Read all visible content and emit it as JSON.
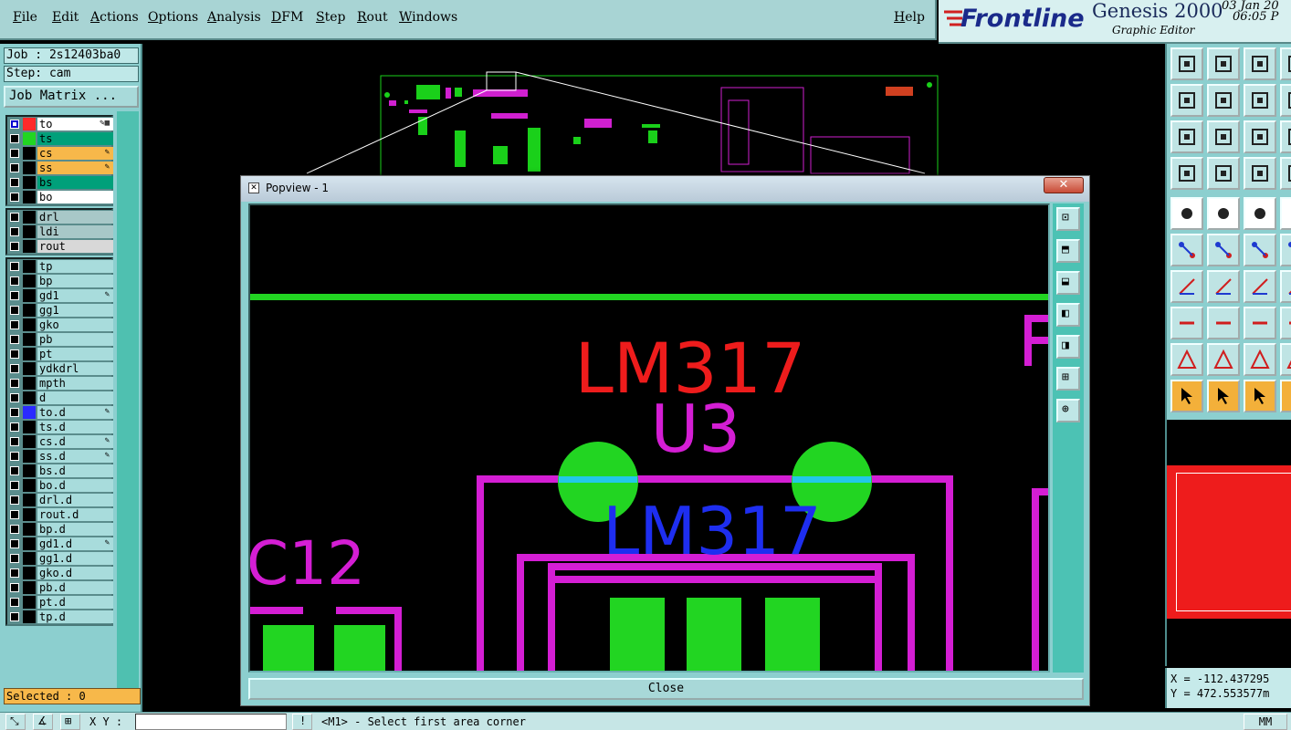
{
  "menubar": {
    "items": [
      "File",
      "Edit",
      "Actions",
      "Options",
      "Analysis",
      "DFM",
      "Step",
      "Rout",
      "Windows"
    ],
    "help": "Help"
  },
  "brand": {
    "logo": "Frontline",
    "product": "Genesis 2000",
    "subtitle": "Graphic Editor",
    "date": "03 Jan 20",
    "time": "06:05 P"
  },
  "left": {
    "job": "Job : 2s12403ba0",
    "step": "Step: cam",
    "job_matrix": "Job Matrix ...",
    "selected": "Selected : 0"
  },
  "layers": {
    "board": [
      {
        "name": "to",
        "color": "#ff2a2a",
        "bg": "#ffffff",
        "checked": true,
        "marker": "#0000d0",
        "icon": "✎▦"
      },
      {
        "name": "ts",
        "color": "#22d522",
        "bg": "#00a07a",
        "checked": false,
        "icon": ""
      },
      {
        "name": "cs",
        "color": "#000000",
        "bg": "#f7b84a",
        "checked": false,
        "icon": "✎"
      },
      {
        "name": "ss",
        "color": "#000000",
        "bg": "#f7b84a",
        "checked": false,
        "icon": "✎"
      },
      {
        "name": "bs",
        "color": "#000000",
        "bg": "#00a07a",
        "checked": false,
        "icon": ""
      },
      {
        "name": "bo",
        "color": "#000000",
        "bg": "#ffffff",
        "checked": false,
        "icon": ""
      }
    ],
    "drill": [
      {
        "name": "drl",
        "color": "#000000",
        "bg": "#a8c8c8",
        "checked": false,
        "icon": ""
      },
      {
        "name": "ldi",
        "color": "#000000",
        "bg": "#a8c8c8",
        "checked": false,
        "icon": ""
      },
      {
        "name": "rout",
        "color": "#000000",
        "bg": "#d8d8d8",
        "checked": false,
        "icon": ""
      }
    ],
    "misc": [
      {
        "name": "tp",
        "color": "#000000",
        "bg": "#a8dcdc",
        "checked": false,
        "icon": ""
      },
      {
        "name": "bp",
        "color": "#000000",
        "bg": "#a8dcdc",
        "checked": false,
        "icon": ""
      },
      {
        "name": "gd1",
        "color": "#000000",
        "bg": "#a8dcdc",
        "checked": false,
        "icon": "✎"
      },
      {
        "name": "gg1",
        "color": "#000000",
        "bg": "#a8dcdc",
        "checked": false,
        "icon": ""
      },
      {
        "name": "gko",
        "color": "#000000",
        "bg": "#a8dcdc",
        "checked": false,
        "icon": ""
      },
      {
        "name": "pb",
        "color": "#000000",
        "bg": "#a8dcdc",
        "checked": false,
        "icon": ""
      },
      {
        "name": "pt",
        "color": "#000000",
        "bg": "#a8dcdc",
        "checked": false,
        "icon": ""
      },
      {
        "name": "ydkdrl",
        "color": "#000000",
        "bg": "#a8dcdc",
        "checked": false,
        "icon": ""
      },
      {
        "name": "mpth",
        "color": "#000000",
        "bg": "#a8dcdc",
        "checked": false,
        "icon": ""
      },
      {
        "name": "d",
        "color": "#000000",
        "bg": "#a8dcdc",
        "checked": false,
        "icon": ""
      },
      {
        "name": "to.d",
        "color": "#2a2aff",
        "bg": "#a8dcdc",
        "checked": false,
        "icon": "✎"
      },
      {
        "name": "ts.d",
        "color": "#000000",
        "bg": "#a8dcdc",
        "checked": false,
        "icon": ""
      },
      {
        "name": "cs.d",
        "color": "#000000",
        "bg": "#a8dcdc",
        "checked": false,
        "icon": "✎"
      },
      {
        "name": "ss.d",
        "color": "#000000",
        "bg": "#a8dcdc",
        "checked": false,
        "icon": "✎"
      },
      {
        "name": "bs.d",
        "color": "#000000",
        "bg": "#a8dcdc",
        "checked": false,
        "icon": ""
      },
      {
        "name": "bo.d",
        "color": "#000000",
        "bg": "#a8dcdc",
        "checked": false,
        "icon": ""
      },
      {
        "name": "drl.d",
        "color": "#000000",
        "bg": "#a8dcdc",
        "checked": false,
        "icon": ""
      },
      {
        "name": "rout.d",
        "color": "#000000",
        "bg": "#a8dcdc",
        "checked": false,
        "icon": ""
      },
      {
        "name": "bp.d",
        "color": "#000000",
        "bg": "#a8dcdc",
        "checked": false,
        "icon": ""
      },
      {
        "name": "gd1.d",
        "color": "#000000",
        "bg": "#a8dcdc",
        "checked": false,
        "icon": "✎"
      },
      {
        "name": "gg1.d",
        "color": "#000000",
        "bg": "#a8dcdc",
        "checked": false,
        "icon": ""
      },
      {
        "name": "gko.d",
        "color": "#000000",
        "bg": "#a8dcdc",
        "checked": false,
        "icon": ""
      },
      {
        "name": "pb.d",
        "color": "#000000",
        "bg": "#a8dcdc",
        "checked": false,
        "icon": ""
      },
      {
        "name": "pt.d",
        "color": "#000000",
        "bg": "#a8dcdc",
        "checked": false,
        "icon": ""
      },
      {
        "name": "tp.d",
        "color": "#000000",
        "bg": "#a8dcdc",
        "checked": false,
        "icon": ""
      }
    ]
  },
  "popup": {
    "title": "Popview - 1",
    "close_label": "Close",
    "tools": [
      "zoom-fit-icon",
      "zoom-home-icon",
      "zoom-down-icon",
      "pan-left-icon",
      "pan-right-icon",
      "zoom-in-icon",
      "zoom-out-icon"
    ],
    "canvas_text": {
      "part_top": "LM317",
      "ref": "U3",
      "part_body": "LM317",
      "cap": "C12",
      "edge": "R"
    }
  },
  "toolbar_icons": [
    "zoom-home-icon",
    "zoom-save-icon",
    "zoom-house-icon",
    "zoom-partial-icon",
    "pan-left-icon",
    "pan-right-icon",
    "pan-reset-icon",
    "pan-partial-icon",
    "zoom-fit-icon",
    "zoom-center-icon",
    "zoom-one-two-icon",
    "zoom-partial-icon",
    "measure-icon",
    "snap-icon",
    "layers-icon",
    "layers-partial-icon",
    "select-point-icon",
    "select-area-icon",
    "ruler-icon",
    "ruler-partial-icon",
    "add-node-icon",
    "cross-icon",
    "move-pad-icon",
    "partial-icon",
    "line-angle-icon",
    "line-draw-icon",
    "arc-icon",
    "partial-icon",
    "pad-add-icon",
    "trace-icon",
    "fit-box-icon",
    "partial-icon",
    "triangle-icon",
    "triangle-select-icon",
    "triangle-up-icon",
    "partial-icon",
    "pointer-icon",
    "pointer-box-icon",
    "pointer-circle-icon",
    "partial-icon"
  ],
  "coords": {
    "x": "X = -112.437295",
    "y": "Y = 472.553577m"
  },
  "status": {
    "xy_label": "X Y :",
    "message": "<M1> - Select first area corner",
    "units": "MM"
  }
}
